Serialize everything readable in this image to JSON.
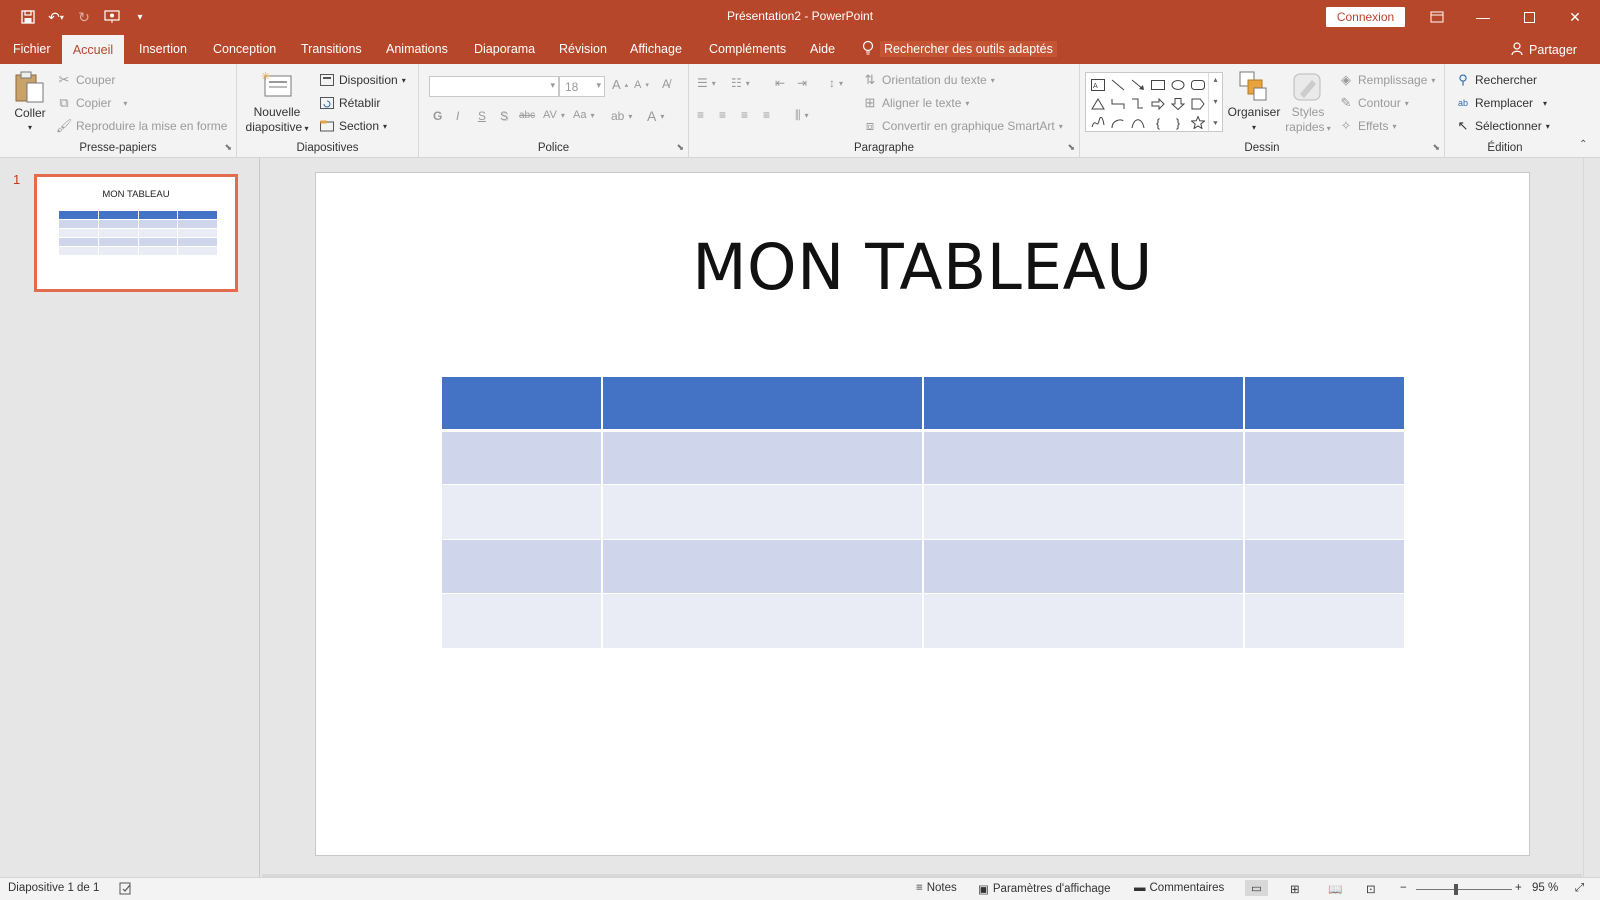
{
  "window": {
    "title": "Présentation2  -  PowerPoint",
    "connexion": "Connexion"
  },
  "tabs": [
    {
      "label": "Fichier"
    },
    {
      "label": "Accueil"
    },
    {
      "label": "Insertion"
    },
    {
      "label": "Conception"
    },
    {
      "label": "Transitions"
    },
    {
      "label": "Animations"
    },
    {
      "label": "Diaporama"
    },
    {
      "label": "Révision"
    },
    {
      "label": "Affichage"
    },
    {
      "label": "Compléments"
    },
    {
      "label": "Aide"
    }
  ],
  "tell_me": "Rechercher des outils adaptés",
  "share": "Partager",
  "ribbon": {
    "clipboard": {
      "label": "Presse-papiers",
      "paste": "Coller",
      "cut": "Couper",
      "copy": "Copier",
      "format_painter": "Reproduire la mise en forme"
    },
    "slides": {
      "label": "Diapositives",
      "new_slide_1": "Nouvelle",
      "new_slide_2": "diapositive",
      "layout": "Disposition",
      "reset": "Rétablir",
      "section": "Section"
    },
    "font": {
      "label": "Police",
      "font_name": "",
      "font_size": "18"
    },
    "paragraph": {
      "label": "Paragraphe",
      "text_direction": "Orientation du texte",
      "align_text": "Aligner le texte",
      "smartart": "Convertir en graphique SmartArt"
    },
    "drawing": {
      "label": "Dessin",
      "arrange": "Organiser",
      "quick_styles_1": "Styles",
      "quick_styles_2": "rapides",
      "fill": "Remplissage",
      "outline": "Contour",
      "effects": "Effets"
    },
    "editing": {
      "label": "Édition",
      "find": "Rechercher",
      "replace": "Remplacer",
      "select": "Sélectionner"
    }
  },
  "thumbnails": [
    {
      "number": "1",
      "title": "MON TABLEAU"
    }
  ],
  "slide": {
    "title": "MON TABLEAU"
  },
  "status": {
    "slide_info": "Diapositive 1 de 1",
    "notes": "Notes",
    "display_settings": "Paramètres d'affichage",
    "comments": "Commentaires",
    "zoom": "95 %"
  },
  "colors": {
    "accent": "#b7472a",
    "table_header": "#4472c4",
    "table_band_1": "#cfd5ea",
    "table_band_2": "#e9ebf5"
  }
}
